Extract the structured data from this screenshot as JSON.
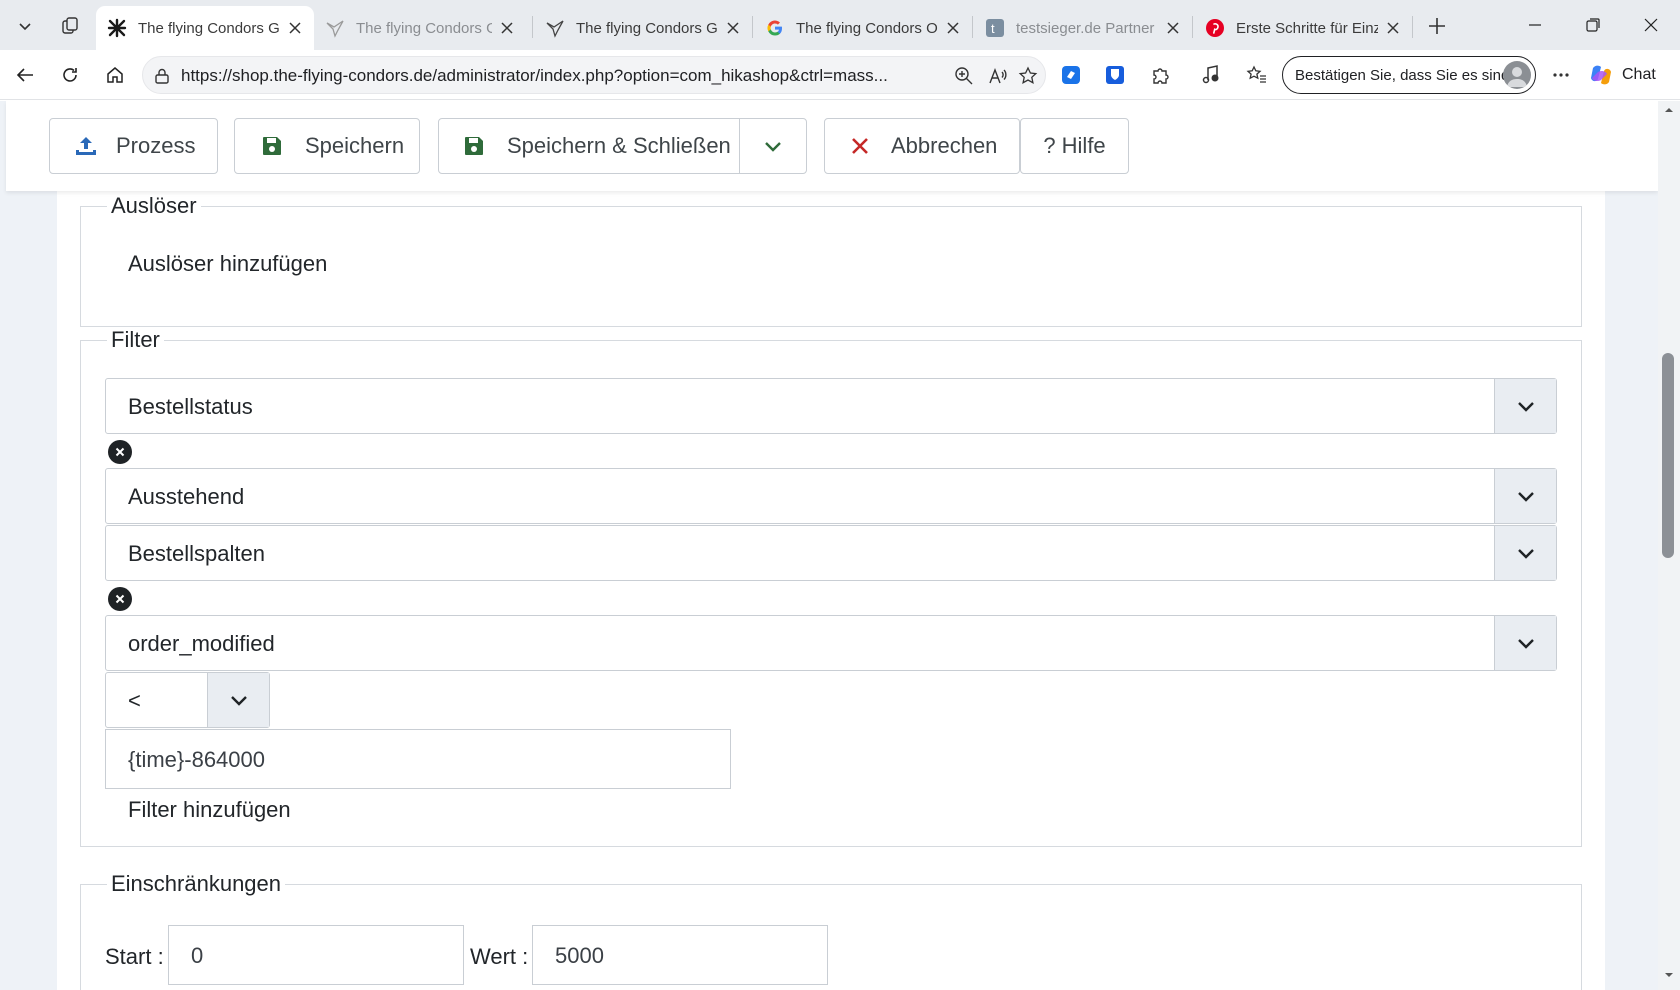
{
  "browser": {
    "tabs": [
      {
        "title": "The flying Condors Gb",
        "icon": "joomla-icon",
        "active": true
      },
      {
        "title": "The flying Condors Gb",
        "icon": "condor-icon",
        "active": false
      },
      {
        "title": "The flying Condors Gb",
        "icon": "condor-icon",
        "active": false
      },
      {
        "title": "The flying Condors On",
        "icon": "google-icon",
        "active": false
      },
      {
        "title": "testsieger.de Partner (",
        "icon": "testsieger-icon",
        "active": false
      },
      {
        "title": "Erste Schritte für Einze",
        "icon": "pinterest-icon",
        "active": false
      }
    ],
    "url": "https://shop.the-flying-condors.de/administrator/index.php?option=com_hikashop&ctrl=mass...",
    "profile_label": "Bestätigen Sie, dass Sie es sind",
    "chat_label": "Chat"
  },
  "toolbar": {
    "process_label": "Prozess",
    "save_label": "Speichern",
    "save_close_label": "Speichern & Schließen",
    "cancel_label": "Abbrechen",
    "help_label": "? Hilfe"
  },
  "colors": {
    "process_icon": "#2a69b8",
    "save_icon": "#2f6b3a",
    "cancel_icon": "#c52827"
  },
  "trigger": {
    "legend": "Auslöser",
    "add_label": "Auslöser hinzufügen"
  },
  "filter": {
    "legend": "Filter",
    "type_1": "Bestellstatus",
    "status_value": "Ausstehend",
    "type_2": "Bestellspalten",
    "column_value": "order_modified",
    "operator_value": "<",
    "value_input": "{time}-864000",
    "add_label": "Filter hinzufügen"
  },
  "limits": {
    "legend": "Einschränkungen",
    "start_label": "Start :",
    "start_value": "0",
    "value_label": "Wert :",
    "value_value": "5000"
  }
}
